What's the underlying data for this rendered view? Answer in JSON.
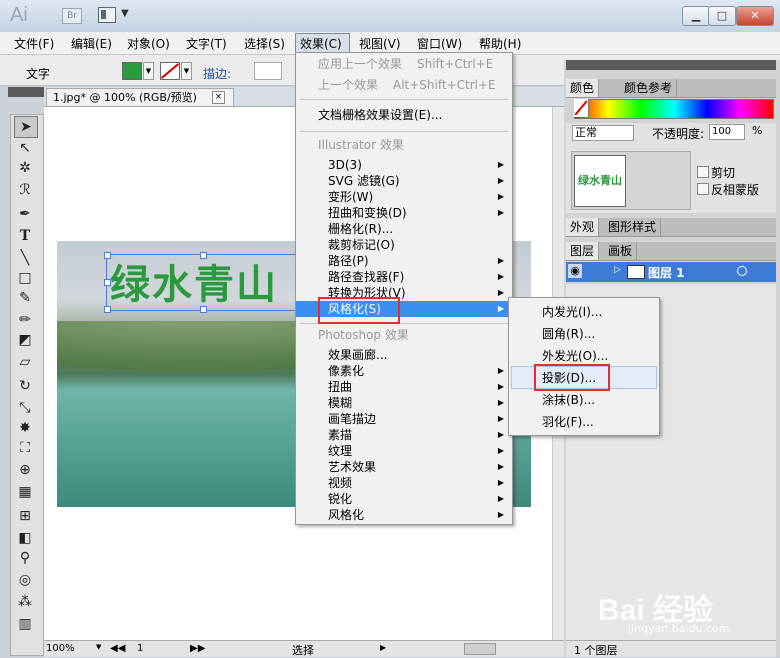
{
  "window": {
    "app_logo": "Ai",
    "bridge_label": "Br",
    "min": "▁",
    "max": "□",
    "close": "✕"
  },
  "menubar": [
    "文件(F)",
    "编辑(E)",
    "对象(O)",
    "文字(T)",
    "选择(S)",
    "效果(C)",
    "视图(V)",
    "窗口(W)",
    "帮助(H)"
  ],
  "control_bar": {
    "mode_label": "文字",
    "stroke_label": "描边:"
  },
  "document": {
    "tab_title": "1.jpg* @ 100% (RGB/预览)",
    "close": "×",
    "headline_text": "绿水青山"
  },
  "status_bar": {
    "zoom": "100%",
    "artboard": "1",
    "tool_status": "选择"
  },
  "effect_menu": {
    "apply_last": "应用上一个效果",
    "apply_last_shortcut": "Shift+Ctrl+E",
    "last_effect": "上一个效果",
    "last_effect_shortcut": "Alt+Shift+Ctrl+E",
    "raster_settings": "文档栅格效果设置(E)...",
    "illustrator_header": "Illustrator 效果",
    "illustrator_items": [
      "3D(3)",
      "SVG 滤镜(G)",
      "变形(W)",
      "扭曲和变换(D)",
      "栅格化(R)...",
      "裁剪标记(O)",
      "路径(P)",
      "路径查找器(F)",
      "转换为形状(V)",
      "风格化(S)"
    ],
    "photoshop_header": "Photoshop 效果",
    "photoshop_items": [
      "效果画廊...",
      "像素化",
      "扭曲",
      "模糊",
      "画笔描边",
      "素描",
      "纹理",
      "艺术效果",
      "视频",
      "锐化",
      "风格化"
    ]
  },
  "stylize_submenu": [
    "内发光(I)...",
    "圆角(R)...",
    "外发光(O)...",
    "投影(D)...",
    "涂抹(B)...",
    "羽化(F)..."
  ],
  "color_panel": {
    "tabs": [
      "颜色",
      "颜色参考"
    ]
  },
  "transparency_panel": {
    "blend_mode": "正常",
    "opacity_label": "不透明度:",
    "opacity_value": "100",
    "percent": "%",
    "thumb_text": "绿水青山",
    "clip_label": "剪切",
    "invert_mask_label": "反相蒙版"
  },
  "appearance_panel": {
    "tabs": [
      "外观",
      "图形样式"
    ]
  },
  "layers_panel": {
    "tabs": [
      "图层",
      "画板"
    ],
    "layer_name": "图层 1",
    "status": "1 个图层"
  },
  "watermark": {
    "text": "Bai 经验",
    "sub": "jingyan.baidu.com"
  },
  "colors": {
    "accent": "#3b8ff0",
    "headline_green": "#2b9a3e",
    "highlight_box": "#e03131"
  }
}
